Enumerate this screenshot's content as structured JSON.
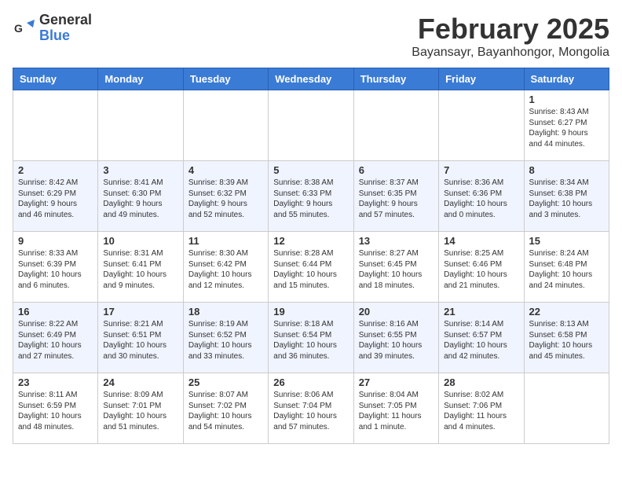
{
  "app": {
    "logo_general": "General",
    "logo_blue": "Blue",
    "title": "February 2025",
    "subtitle": "Bayansayr, Bayanhongor, Mongolia"
  },
  "calendar": {
    "headers": [
      "Sunday",
      "Monday",
      "Tuesday",
      "Wednesday",
      "Thursday",
      "Friday",
      "Saturday"
    ],
    "weeks": [
      [
        {
          "day": "",
          "info": ""
        },
        {
          "day": "",
          "info": ""
        },
        {
          "day": "",
          "info": ""
        },
        {
          "day": "",
          "info": ""
        },
        {
          "day": "",
          "info": ""
        },
        {
          "day": "",
          "info": ""
        },
        {
          "day": "1",
          "info": "Sunrise: 8:43 AM\nSunset: 6:27 PM\nDaylight: 9 hours\nand 44 minutes."
        }
      ],
      [
        {
          "day": "2",
          "info": "Sunrise: 8:42 AM\nSunset: 6:29 PM\nDaylight: 9 hours\nand 46 minutes."
        },
        {
          "day": "3",
          "info": "Sunrise: 8:41 AM\nSunset: 6:30 PM\nDaylight: 9 hours\nand 49 minutes."
        },
        {
          "day": "4",
          "info": "Sunrise: 8:39 AM\nSunset: 6:32 PM\nDaylight: 9 hours\nand 52 minutes."
        },
        {
          "day": "5",
          "info": "Sunrise: 8:38 AM\nSunset: 6:33 PM\nDaylight: 9 hours\nand 55 minutes."
        },
        {
          "day": "6",
          "info": "Sunrise: 8:37 AM\nSunset: 6:35 PM\nDaylight: 9 hours\nand 57 minutes."
        },
        {
          "day": "7",
          "info": "Sunrise: 8:36 AM\nSunset: 6:36 PM\nDaylight: 10 hours\nand 0 minutes."
        },
        {
          "day": "8",
          "info": "Sunrise: 8:34 AM\nSunset: 6:38 PM\nDaylight: 10 hours\nand 3 minutes."
        }
      ],
      [
        {
          "day": "9",
          "info": "Sunrise: 8:33 AM\nSunset: 6:39 PM\nDaylight: 10 hours\nand 6 minutes."
        },
        {
          "day": "10",
          "info": "Sunrise: 8:31 AM\nSunset: 6:41 PM\nDaylight: 10 hours\nand 9 minutes."
        },
        {
          "day": "11",
          "info": "Sunrise: 8:30 AM\nSunset: 6:42 PM\nDaylight: 10 hours\nand 12 minutes."
        },
        {
          "day": "12",
          "info": "Sunrise: 8:28 AM\nSunset: 6:44 PM\nDaylight: 10 hours\nand 15 minutes."
        },
        {
          "day": "13",
          "info": "Sunrise: 8:27 AM\nSunset: 6:45 PM\nDaylight: 10 hours\nand 18 minutes."
        },
        {
          "day": "14",
          "info": "Sunrise: 8:25 AM\nSunset: 6:46 PM\nDaylight: 10 hours\nand 21 minutes."
        },
        {
          "day": "15",
          "info": "Sunrise: 8:24 AM\nSunset: 6:48 PM\nDaylight: 10 hours\nand 24 minutes."
        }
      ],
      [
        {
          "day": "16",
          "info": "Sunrise: 8:22 AM\nSunset: 6:49 PM\nDaylight: 10 hours\nand 27 minutes."
        },
        {
          "day": "17",
          "info": "Sunrise: 8:21 AM\nSunset: 6:51 PM\nDaylight: 10 hours\nand 30 minutes."
        },
        {
          "day": "18",
          "info": "Sunrise: 8:19 AM\nSunset: 6:52 PM\nDaylight: 10 hours\nand 33 minutes."
        },
        {
          "day": "19",
          "info": "Sunrise: 8:18 AM\nSunset: 6:54 PM\nDaylight: 10 hours\nand 36 minutes."
        },
        {
          "day": "20",
          "info": "Sunrise: 8:16 AM\nSunset: 6:55 PM\nDaylight: 10 hours\nand 39 minutes."
        },
        {
          "day": "21",
          "info": "Sunrise: 8:14 AM\nSunset: 6:57 PM\nDaylight: 10 hours\nand 42 minutes."
        },
        {
          "day": "22",
          "info": "Sunrise: 8:13 AM\nSunset: 6:58 PM\nDaylight: 10 hours\nand 45 minutes."
        }
      ],
      [
        {
          "day": "23",
          "info": "Sunrise: 8:11 AM\nSunset: 6:59 PM\nDaylight: 10 hours\nand 48 minutes."
        },
        {
          "day": "24",
          "info": "Sunrise: 8:09 AM\nSunset: 7:01 PM\nDaylight: 10 hours\nand 51 minutes."
        },
        {
          "day": "25",
          "info": "Sunrise: 8:07 AM\nSunset: 7:02 PM\nDaylight: 10 hours\nand 54 minutes."
        },
        {
          "day": "26",
          "info": "Sunrise: 8:06 AM\nSunset: 7:04 PM\nDaylight: 10 hours\nand 57 minutes."
        },
        {
          "day": "27",
          "info": "Sunrise: 8:04 AM\nSunset: 7:05 PM\nDaylight: 11 hours\nand 1 minute."
        },
        {
          "day": "28",
          "info": "Sunrise: 8:02 AM\nSunset: 7:06 PM\nDaylight: 11 hours\nand 4 minutes."
        },
        {
          "day": "",
          "info": ""
        }
      ]
    ]
  }
}
